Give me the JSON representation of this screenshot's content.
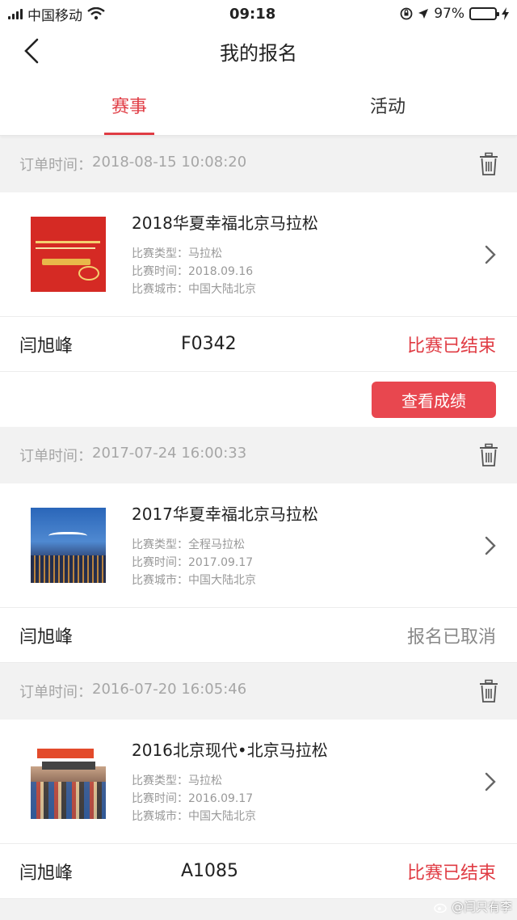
{
  "status_bar": {
    "carrier": "中国移动",
    "time": "09:18",
    "battery": "97%",
    "battery_level": 0.97
  },
  "header": {
    "title": "我的报名"
  },
  "tabs": [
    {
      "label": "赛事",
      "active": true
    },
    {
      "label": "活动",
      "active": false
    }
  ],
  "labels": {
    "order_time": "订单时间：",
    "type": "比赛类型：",
    "date": "比赛时间：",
    "city": "比赛城市："
  },
  "orders": [
    {
      "order_time": "2018-08-15 10:08:20",
      "event_name": "2018华夏幸福北京马拉松",
      "type": "马拉松",
      "date": "2018.09.16",
      "city": "中国大陆北京",
      "runner": "闫旭峰",
      "bib": "F0342",
      "status": "比赛已结束",
      "action": "查看成绩"
    },
    {
      "order_time": "2017-07-24 16:00:33",
      "event_name": "2017华夏幸福北京马拉松",
      "type": "全程马拉松",
      "date": "2017.09.17",
      "city": "中国大陆北京",
      "runner": "闫旭峰",
      "bib": "",
      "status": "报名已取消"
    },
    {
      "order_time": "2016-07-20 16:05:46",
      "event_name": "2016北京现代•北京马拉松",
      "type": "马拉松",
      "date": "2016.09.17",
      "city": "中国大陆北京",
      "runner": "闫旭峰",
      "bib": "A1085",
      "status": "比赛已结束"
    }
  ],
  "watermark": "@闫只有李",
  "colors": {
    "accent": "#e03c44",
    "button": "#e8474f",
    "background": "#f2f2f2"
  },
  "icons": [
    "back-chevron-icon",
    "trash-icon",
    "chevron-right-icon",
    "wifi-icon",
    "location-icon",
    "orientation-lock-icon",
    "charging-icon"
  ]
}
